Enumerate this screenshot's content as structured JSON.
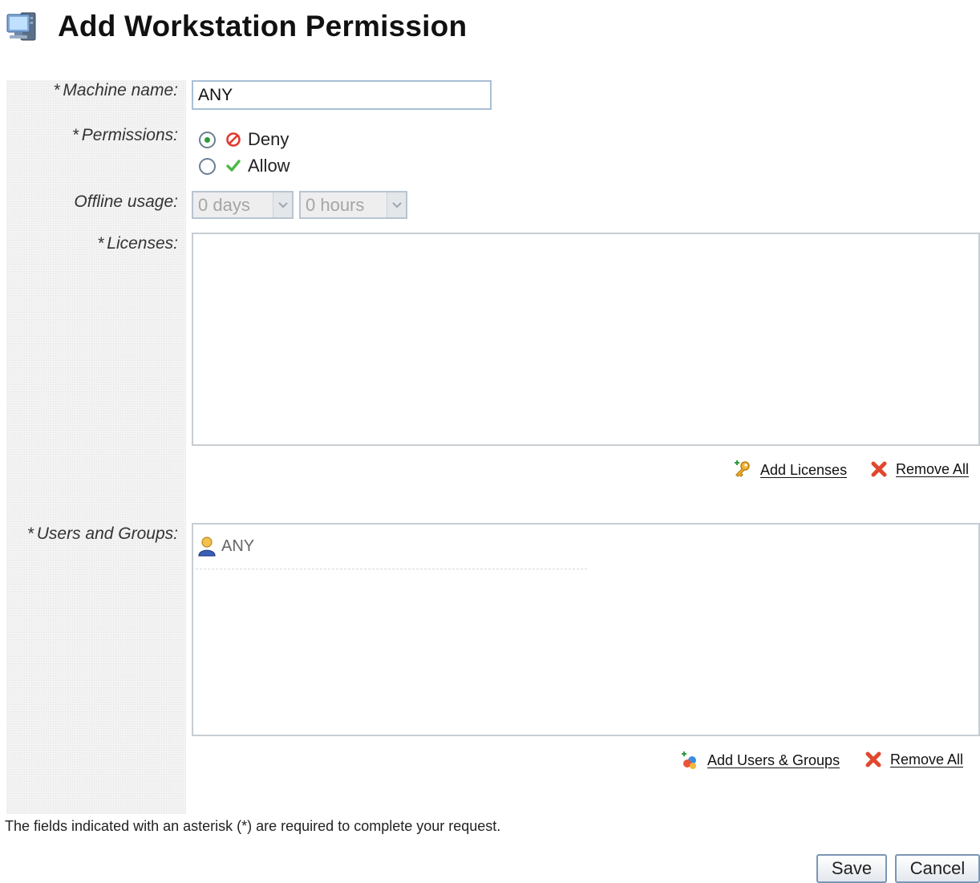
{
  "page": {
    "title": "Add Workstation Permission",
    "icon": "computer-workstation-icon"
  },
  "form": {
    "machine_name": {
      "label": "Machine name:",
      "required_marker": "*",
      "value": "ANY"
    },
    "permissions": {
      "label": "Permissions:",
      "required_marker": "*",
      "options": [
        {
          "label": "Deny",
          "icon": "deny-icon",
          "selected": true
        },
        {
          "label": "Allow",
          "icon": "allow-check-icon",
          "selected": false
        }
      ]
    },
    "offline_usage": {
      "label": "Offline usage:",
      "days_value": "0 days",
      "hours_value": "0 hours",
      "disabled": true
    },
    "licenses": {
      "label": "Licenses:",
      "required_marker": "*",
      "items": [],
      "add_link": "Add Licenses",
      "remove_all_link": "Remove All"
    },
    "users_groups": {
      "label": "Users and Groups:",
      "required_marker": "*",
      "items": [
        {
          "name": "ANY",
          "icon": "user-icon"
        }
      ],
      "add_link": "Add Users & Groups",
      "remove_all_link": "Remove All"
    }
  },
  "footnote": "The fields indicated with an asterisk (*) are required to complete your request.",
  "buttons": {
    "save": "Save",
    "cancel": "Cancel"
  },
  "colors": {
    "accent_border": "#a9bfd6",
    "deny": "#e03a2e",
    "allow": "#4cb847",
    "label_column_bg": "#f3f3f3"
  }
}
